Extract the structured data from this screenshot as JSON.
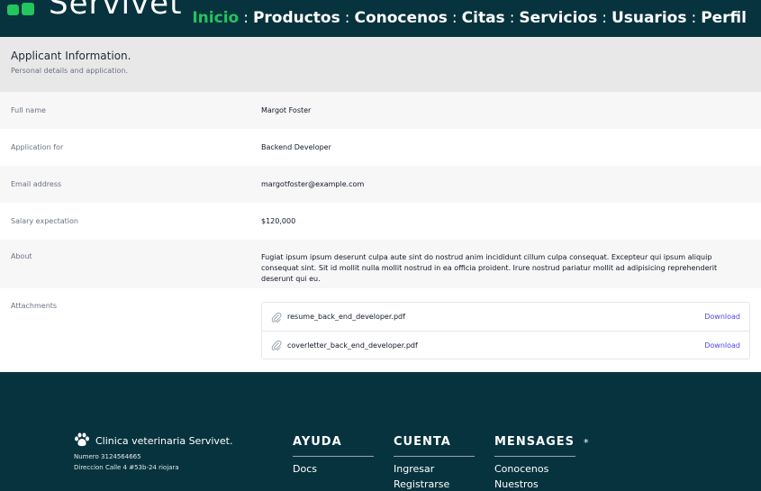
{
  "brand": {
    "logo_icon": "green-paw-logo",
    "name": "Servivet"
  },
  "nav": {
    "items": [
      {
        "label": "Inicio",
        "active": true
      },
      {
        "label": "Productos",
        "active": false
      },
      {
        "label": "Conocenos",
        "active": false
      },
      {
        "label": "Citas",
        "active": false
      },
      {
        "label": "Servicios",
        "active": false
      },
      {
        "label": "Usuarios",
        "active": false
      },
      {
        "label": "Perfil",
        "active": false
      }
    ],
    "separator": ":",
    "active_color": "#22c55e"
  },
  "header": {
    "title": "Applicant Information.",
    "subtitle": "Personal details and application."
  },
  "fields": {
    "full_name": {
      "label": "Full name",
      "value": "Margot Foster"
    },
    "application_for": {
      "label": "Application for",
      "value": "Backend Developer"
    },
    "email": {
      "label": "Email address",
      "value": "margotfoster@example.com"
    },
    "salary": {
      "label": "Salary expectation",
      "value": "$120,000"
    },
    "about": {
      "label": "About",
      "value": "Fugiat ipsum ipsum deserunt culpa aute sint do nostrud anim incididunt cillum culpa consequat. Excepteur qui ipsum aliquip consequat sint. Sit id mollit nulla mollit nostrud in ea officia proident. Irure nostrud pariatur mollit ad adipisicing reprehenderit deserunt qui eu."
    },
    "attachments": {
      "label": "Attachments",
      "files": [
        {
          "name": "resume_back_end_developer.pdf",
          "action": "Download"
        },
        {
          "name": "coverletter_back_end_developer.pdf",
          "action": "Download"
        }
      ]
    }
  },
  "footer": {
    "clinic": {
      "icon": "paw-icon",
      "title": "Clinica veterinaria Servivet.",
      "phone": "Numero 3124564665",
      "address": "Direccion Calle 4 #53b-24 riojara"
    },
    "columns": [
      {
        "heading": "AYUDA",
        "links": [
          "Docs"
        ]
      },
      {
        "heading": "CUENTA",
        "links": [
          "Ingresar",
          "Registrarse"
        ]
      },
      {
        "heading": "MENSAGES",
        "links": [
          "Conocenos",
          "Nuestros"
        ]
      }
    ],
    "star": "*"
  },
  "colors": {
    "dark_teal": "#07333e",
    "accent_green": "#22c55e",
    "link_indigo": "#4f46e5"
  }
}
